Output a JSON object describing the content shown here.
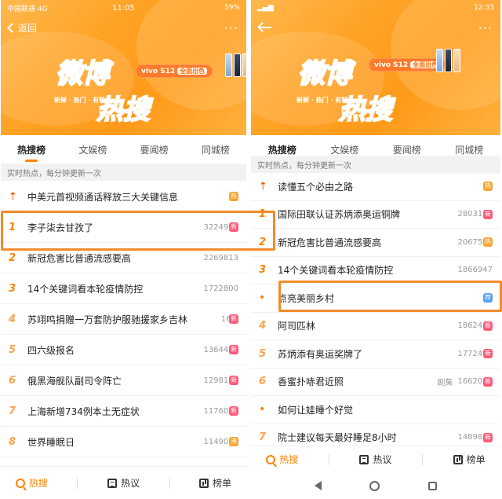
{
  "left": {
    "status": {
      "carrier": "中国联通 4G",
      "time": "11:05",
      "battery": "59%"
    },
    "nav": {
      "back_label": "返回",
      "more": "···"
    },
    "banner": {
      "logo_line1": "微博",
      "logo_line2": "热搜",
      "slogan": "新鲜 · 热门 · 有料",
      "promo": "vivo S12",
      "promo_cn": "全面出色"
    },
    "tabs": [
      "热搜榜",
      "文娱榜",
      "要闻榜",
      "同城榜"
    ],
    "subhead": "实时热点，每分钟更新一次",
    "items": [
      {
        "rank": "",
        "title": "中美元首视频通话释放三大关键信息",
        "count": "",
        "badge": "热",
        "badge_color": "#f7a533"
      },
      {
        "rank": "1",
        "title": "李子柒去甘孜了",
        "count": "3224956",
        "badge": "新",
        "badge_color": "#ff5a7a"
      },
      {
        "rank": "2",
        "title": "新冠危害比普通流感要高",
        "count": "2269813",
        "badge": "",
        "badge_color": ""
      },
      {
        "rank": "3",
        "title": "14个关键词看本轮疫情防控",
        "count": "1722800",
        "badge": "",
        "badge_color": ""
      },
      {
        "rank": "4",
        "title": "苏翊鸣捐赠一万套防护服驰援家乡吉林",
        "count": "16...",
        "badge": "新",
        "badge_color": "#ff5a7a"
      },
      {
        "rank": "5",
        "title": "四六级报名",
        "count": "1364405",
        "badge": "新",
        "badge_color": "#ff5a7a"
      },
      {
        "rank": "6",
        "title": "俄黑海舰队副司令阵亡",
        "count": "1298106",
        "badge": "新",
        "badge_color": "#ff5a7a"
      },
      {
        "rank": "7",
        "title": "上海新增734例本土无症状",
        "count": "1176008",
        "badge": "新",
        "badge_color": "#ff5a7a"
      },
      {
        "rank": "8",
        "title": "世界睡眠日",
        "count": "1149056",
        "badge": "沸",
        "badge_color": "#f7a533"
      }
    ],
    "bottomnav": [
      "热搜",
      "热议",
      "榜单"
    ]
  },
  "right": {
    "status": {
      "time": "12:33"
    },
    "nav": {
      "more": "···"
    },
    "banner": {
      "logo_line1": "微博",
      "logo_line2": "热搜",
      "slogan": "新鲜 · 热门 · 有料",
      "promo": "vivo S12",
      "promo_cn": "全面出色"
    },
    "tabs": [
      "热搜榜",
      "文娱榜",
      "要闻榜",
      "同城榜"
    ],
    "subhead": "实时热点，每分钟更新一次",
    "items": [
      {
        "rank": "",
        "title": "读懂五个必由之路",
        "count": "",
        "ju": "",
        "badge": "热",
        "badge_color": "#f7a533"
      },
      {
        "rank": "1",
        "title": "国际田联认证苏炳添奥运铜牌",
        "count": "2803143",
        "ju": "",
        "badge": "新",
        "badge_color": "#ff5a7a"
      },
      {
        "rank": "2",
        "title": "新冠危害比普通流感要高",
        "count": "2067566",
        "ju": "",
        "badge": "热",
        "badge_color": "#f7a533"
      },
      {
        "rank": "3",
        "title": "14个关键词看本轮疫情防控",
        "count": "1866947",
        "ju": "",
        "badge": "",
        "badge_color": ""
      },
      {
        "rank": "•",
        "title": "点亮美丽乡村",
        "count": "",
        "ju": "",
        "badge": "荐",
        "badge_color": "#5aa0f0"
      },
      {
        "rank": "4",
        "title": "阿司匹林",
        "count": "1862404",
        "ju": "",
        "badge": "新",
        "badge_color": "#ff5a7a"
      },
      {
        "rank": "5",
        "title": "苏炳添有奥运奖牌了",
        "count": "1772445",
        "ju": "",
        "badge": "新",
        "badge_color": "#ff5a7a"
      },
      {
        "rank": "6",
        "title": "香蜜扑哧君近照",
        "count": "1662035",
        "ju": "剧集",
        "badge": "新",
        "badge_color": "#ff5a7a"
      },
      {
        "rank": "•",
        "title": "如何让娃睡个好觉",
        "count": "",
        "ju": "",
        "badge": "",
        "badge_color": ""
      },
      {
        "rank": "7",
        "title": "院士建议每天最好睡足8小时",
        "count": "1489843",
        "ju": "",
        "badge": "新",
        "badge_color": "#ff5a7a"
      }
    ],
    "bottomnav": [
      "热搜",
      "热议",
      "榜单"
    ]
  }
}
